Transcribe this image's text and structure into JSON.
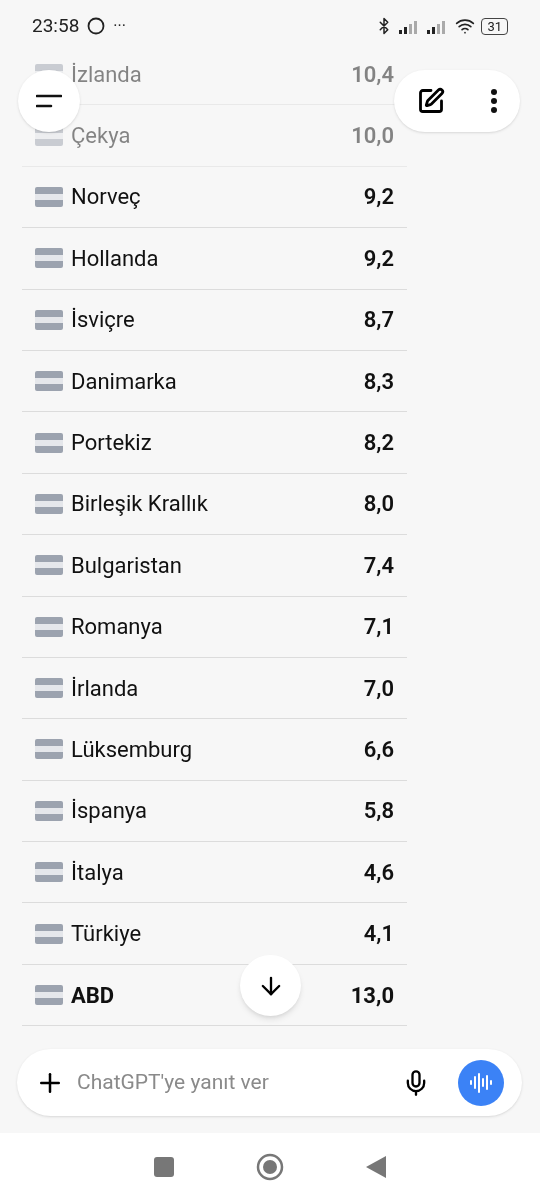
{
  "status_bar": {
    "time": "23:58",
    "more": "···",
    "battery": "31"
  },
  "rows": [
    {
      "country": "İzlanda",
      "value": "10,4",
      "faded": true,
      "bold": false
    },
    {
      "country": "Çekya",
      "value": "10,0",
      "faded": true,
      "bold": false
    },
    {
      "country": "Norveç",
      "value": "9,2",
      "faded": false,
      "bold": false
    },
    {
      "country": "Hollanda",
      "value": "9,2",
      "faded": false,
      "bold": false
    },
    {
      "country": "İsviçre",
      "value": "8,7",
      "faded": false,
      "bold": false
    },
    {
      "country": "Danimarka",
      "value": "8,3",
      "faded": false,
      "bold": false
    },
    {
      "country": "Portekiz",
      "value": "8,2",
      "faded": false,
      "bold": false
    },
    {
      "country": "Birleşik Krallık",
      "value": "8,0",
      "faded": false,
      "bold": false
    },
    {
      "country": "Bulgaristan",
      "value": "7,4",
      "faded": false,
      "bold": false
    },
    {
      "country": "Romanya",
      "value": "7,1",
      "faded": false,
      "bold": false
    },
    {
      "country": "İrlanda",
      "value": "7,0",
      "faded": false,
      "bold": false
    },
    {
      "country": "Lüksemburg",
      "value": "6,6",
      "faded": false,
      "bold": false
    },
    {
      "country": "İspanya",
      "value": "5,8",
      "faded": false,
      "bold": false
    },
    {
      "country": "İtalya",
      "value": "4,6",
      "faded": false,
      "bold": false
    },
    {
      "country": "Türkiye",
      "value": "4,1",
      "faded": false,
      "bold": false
    },
    {
      "country": "ABD",
      "value": "13,0",
      "faded": false,
      "bold": true
    }
  ],
  "composer": {
    "placeholder": "ChatGPT'ye yanıt ver"
  }
}
